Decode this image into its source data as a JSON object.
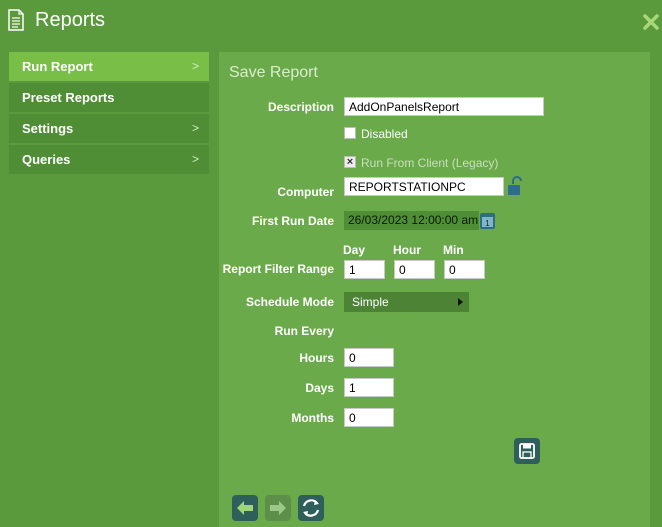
{
  "header": {
    "title": "Reports"
  },
  "sidebar": {
    "items": [
      {
        "label": "Run Report",
        "chevron": ">"
      },
      {
        "label": "Preset Reports",
        "chevron": ""
      },
      {
        "label": "Settings",
        "chevron": ">"
      },
      {
        "label": "Queries",
        "chevron": ">"
      }
    ]
  },
  "form": {
    "title": "Save Report",
    "description_label": "Description",
    "description_value": "AddOnPanelsReport",
    "disabled_label": "Disabled",
    "run_from_client_label": "Run From Client (Legacy)",
    "computer_label": "Computer",
    "computer_value": "REPORTSTATIONPC",
    "first_run_label": "First Run Date",
    "first_run_value": "26/03/2023 12:00:00 am",
    "filter_range_label": "Report Filter Range",
    "day_label": "Day",
    "hour_label": "Hour",
    "min_label": "Min",
    "day_value": "1",
    "hour_value": "0",
    "min_value": "0",
    "schedule_mode_label": "Schedule Mode",
    "schedule_mode_value": "Simple",
    "run_every_label": "Run Every",
    "hours_label": "Hours",
    "hours_value": "0",
    "days_label": "Days",
    "days_value": "1",
    "months_label": "Months",
    "months_value": "0"
  },
  "colors": {
    "background": "#5a9a3c",
    "panel": "#6aaa4a",
    "sidebar_active": "#79be47",
    "sidebar_item": "#4f8e35",
    "icon_button": "#2e5f5a"
  }
}
